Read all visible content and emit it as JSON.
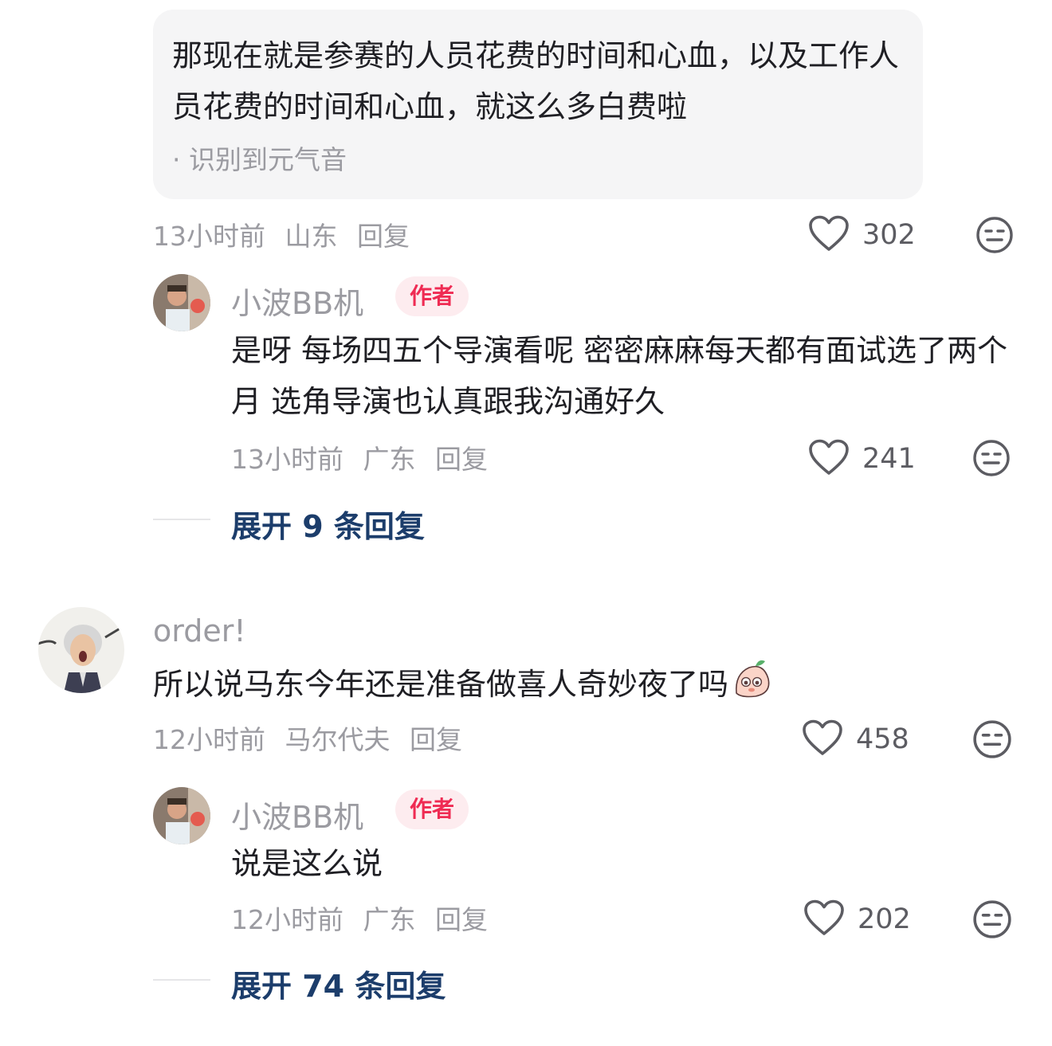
{
  "voice_reply": {
    "text": "那现在就是参赛的人员花费的时间和心血，以及工作人员花费的时间和心血，就这么多白费啦",
    "note": "· 识别到元气音",
    "time": "13小时前",
    "location": "山东",
    "reply": "回复",
    "likes": "302"
  },
  "comments": [
    {
      "username": "小波BB机",
      "badge": "作者",
      "text": "是呀 每场四五个导演看呢 密密麻麻每天都有面试选了两个月 选角导演也认真跟我沟通好久",
      "time": "13小时前",
      "location": "广东",
      "reply": "回复",
      "likes": "241"
    },
    {
      "username": "order!",
      "text": "所以说马东今年还是准备做喜人奇妙夜了吗",
      "time": "12小时前",
      "location": "马尔代夫",
      "reply": "回复",
      "likes": "458"
    },
    {
      "username": "小波BB机",
      "badge": "作者",
      "text": "说是这么说",
      "time": "12小时前",
      "location": "广东",
      "reply": "回复",
      "likes": "202"
    }
  ],
  "expand": [
    {
      "label": "展开 9 条回复"
    },
    {
      "label": "展开 74 条回复"
    }
  ],
  "colors": {
    "author_badge": "#ef2b53",
    "expand_link": "#1c3d6b",
    "meta_gray": "#9b9ba1"
  },
  "icons": [
    "heart-icon",
    "dislike-face-icon",
    "emoji-sticker-icon"
  ]
}
